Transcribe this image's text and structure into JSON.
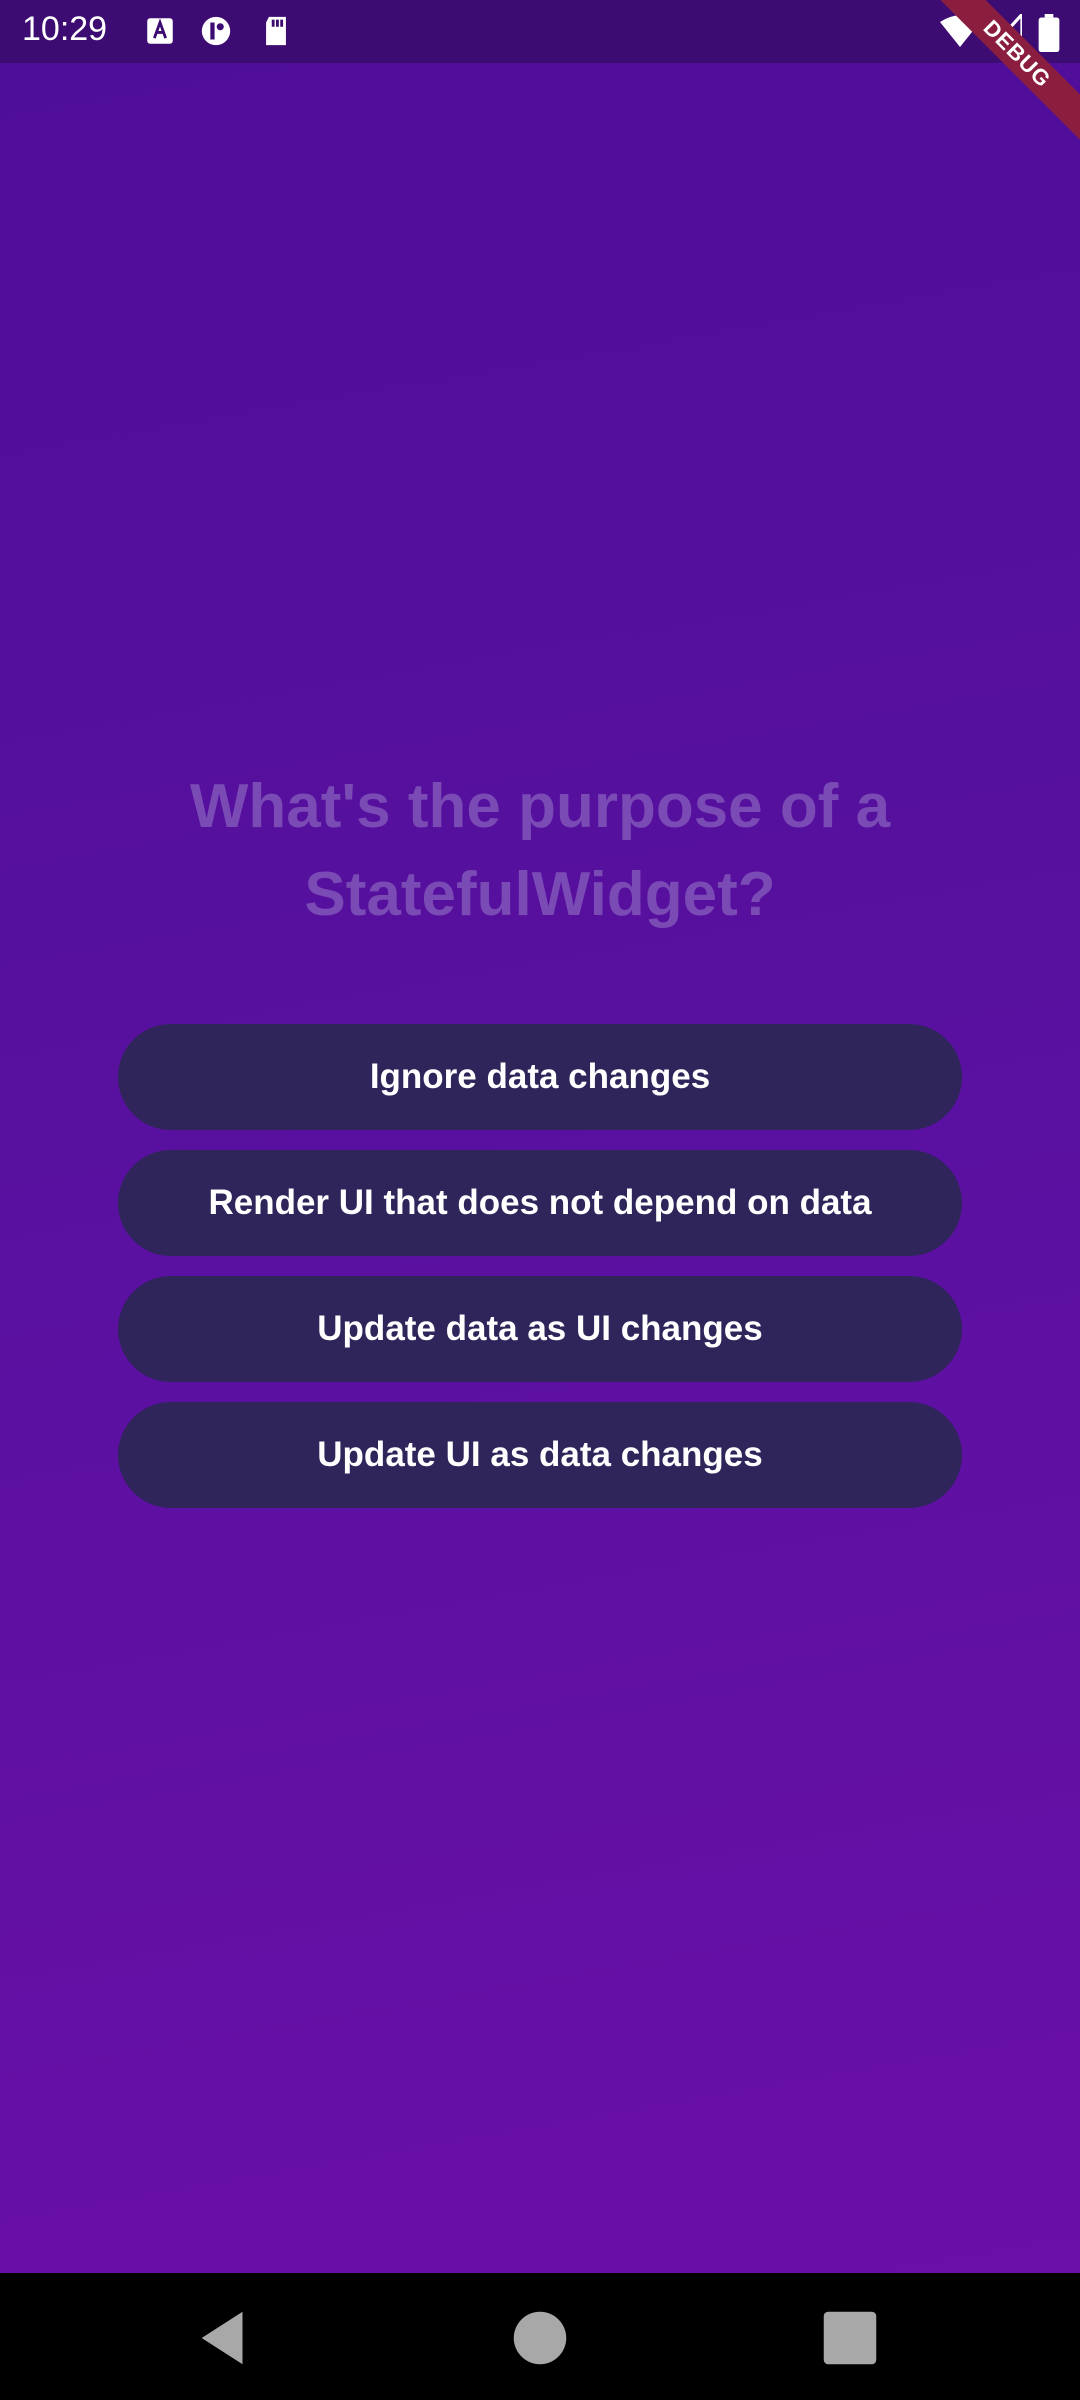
{
  "status_bar": {
    "time": "10:29",
    "left_icons": [
      "a-notification-icon",
      "app-notification-icon",
      "sd-card-icon"
    ],
    "right_icons": [
      "wifi-icon",
      "signal-icon",
      "battery-icon"
    ]
  },
  "debug_banner": "DEBUG",
  "quiz": {
    "question": "What's the purpose of a StatefulWidget?",
    "answers": [
      "Ignore data changes",
      "Render UI that does not depend on data",
      "Update data as UI changes",
      "Update UI as data changes"
    ]
  },
  "nav_bar": {
    "buttons": [
      "back-icon",
      "home-icon",
      "recents-icon"
    ]
  },
  "colors": {
    "status_bar": "#3d0c72",
    "background_top": "#4f0e99",
    "background_bottom": "#6a0fa8",
    "question_text": "#7a4ab5",
    "button_bg": "#2f255a",
    "button_text": "#ffffff",
    "debug_banner": "#8b1d3f"
  }
}
